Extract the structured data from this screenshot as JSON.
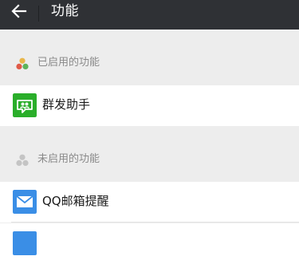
{
  "header": {
    "title": "功能",
    "back_icon": "arrow-left-icon"
  },
  "enabled_section": {
    "label": "已启用的功能",
    "icon": "three-dots-colored-icon",
    "items": [
      {
        "label": "群发助手",
        "icon": "group-send-icon",
        "icon_color": "#2aae2a"
      }
    ]
  },
  "disabled_section": {
    "label": "未启用的功能",
    "icon": "three-dots-gray-icon",
    "items": [
      {
        "label": "QQ邮箱提醒",
        "icon": "mail-icon",
        "icon_color": "#3a8ee6"
      }
    ]
  },
  "colors": {
    "topbar": "#2f3135",
    "background": "#ededed",
    "row": "#ffffff",
    "secondary_text": "#8a8a8a"
  }
}
